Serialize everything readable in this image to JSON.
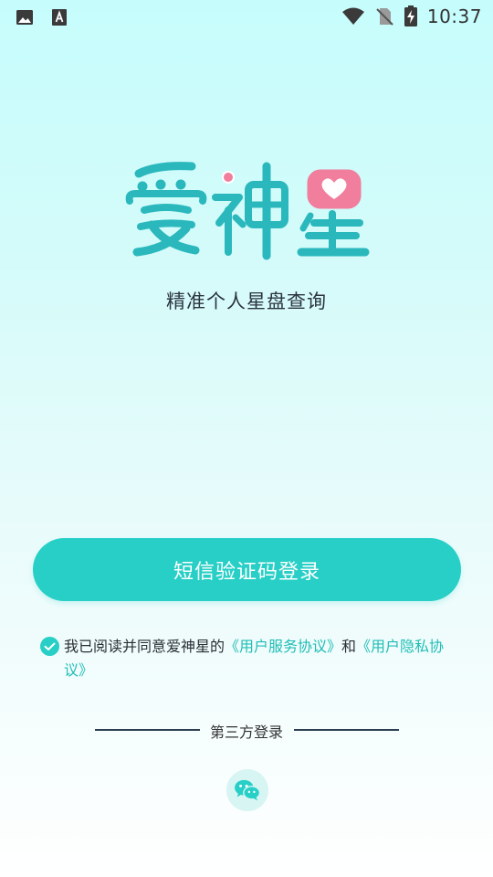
{
  "status_bar": {
    "time": "10:37",
    "icons": [
      "image-icon",
      "font-download-icon",
      "wifi-icon",
      "no-sim-icon",
      "battery-charging-icon"
    ]
  },
  "logo": {
    "text": "爱神星"
  },
  "tagline": "精准个人星盘查询",
  "primary_button": {
    "label": "短信验证码登录"
  },
  "agreement": {
    "checked": true,
    "prefix": "我已阅读并同意爱神星的",
    "link_service": "《用户服务协议》",
    "joiner": "和",
    "link_privacy": "《用户隐私协议》"
  },
  "third_party": {
    "label": "第三方登录",
    "wechat_icon": "wechat-icon"
  },
  "colors": {
    "accent": "#27cfc6",
    "link": "#1fbdb5",
    "logo_teal": "#2ab8bd",
    "logo_pink": "#f07e9c"
  }
}
